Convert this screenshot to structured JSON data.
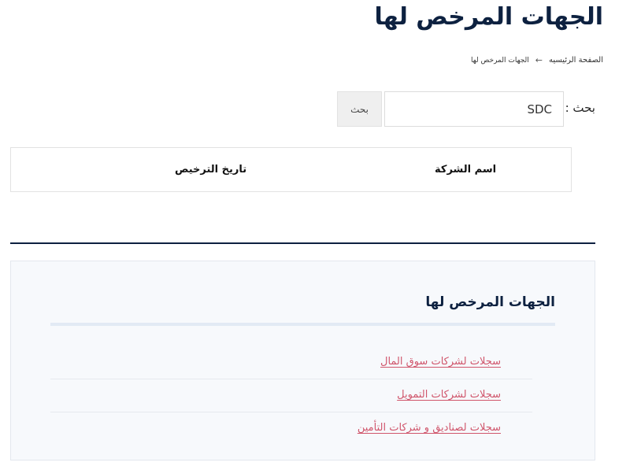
{
  "page": {
    "title": "الجهات المرخص لها"
  },
  "breadcrumb": {
    "home": "الصفحة الرئيسيه",
    "separator_icon": "arrow-left-icon",
    "separator": "←",
    "current": "الجهات المرخص لها"
  },
  "search": {
    "label": "بحث :",
    "value": "SDC",
    "button_label": "بحث"
  },
  "table": {
    "columns": [
      "اسم الشركة",
      "تاريخ الترخيص"
    ]
  },
  "sidebar": {
    "title": "الجهات المرخص لها",
    "links": [
      {
        "label": "سجلات لشركات سوق المال"
      },
      {
        "label": "سجلات لشركات التمويل"
      },
      {
        "label": "سجلات لصناديق و شركات التأمين"
      }
    ]
  },
  "colors": {
    "title": "#0d2140",
    "divider": "#0d2140",
    "link": "#d0566c",
    "panel_bg": "#f7f9fc",
    "panel_underline": "#e2eaf4"
  }
}
